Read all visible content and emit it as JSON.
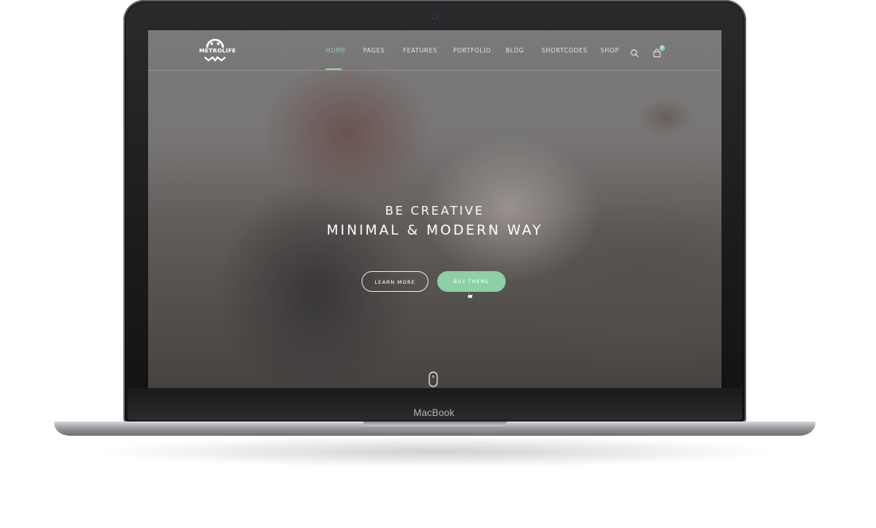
{
  "device": {
    "brand_label": "MacBook"
  },
  "site": {
    "logo_text": "METROLIFE",
    "nav": {
      "items": [
        {
          "label": "HOME",
          "active": true
        },
        {
          "label": "PAGES",
          "active": false
        },
        {
          "label": "FEATURES",
          "active": false
        },
        {
          "label": "PORTFOLIO",
          "active": false
        },
        {
          "label": "BLOG",
          "active": false
        },
        {
          "label": "SHORTCODES",
          "active": false
        },
        {
          "label": "SHOP",
          "active": false
        }
      ],
      "search_icon": "search-icon",
      "cart_icon": "cart-icon",
      "cart_count": "0"
    },
    "hero": {
      "subtitle": "BE CREATIVE",
      "title": "MINIMAL & MODERN WAY",
      "learn_more_label": "LEARN MORE",
      "buy_theme_label": "BUY THEME",
      "scroll_icon": "mouse-scroll-icon"
    },
    "colors": {
      "accent": "#8dd1a8",
      "button_fill": "#8dcfa6"
    }
  }
}
